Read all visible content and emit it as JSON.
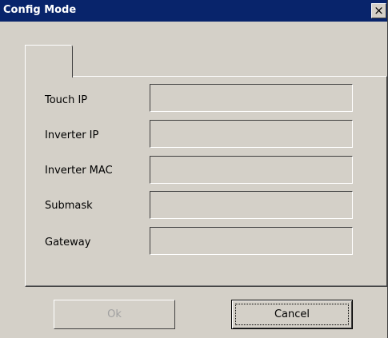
{
  "window": {
    "title": "Config Mode",
    "close_glyph": "×"
  },
  "tab": {
    "label": ""
  },
  "fields": [
    {
      "label": "Touch IP",
      "value": ""
    },
    {
      "label": "Inverter IP",
      "value": ""
    },
    {
      "label": "Inverter MAC",
      "value": ""
    },
    {
      "label": "Submask",
      "value": ""
    },
    {
      "label": "Gateway",
      "value": ""
    }
  ],
  "buttons": {
    "ok": "Ok",
    "cancel": "Cancel"
  },
  "colors": {
    "titlebar": "#08246b",
    "face": "#d4d0c8",
    "disabled_text": "#a0a0a0"
  }
}
